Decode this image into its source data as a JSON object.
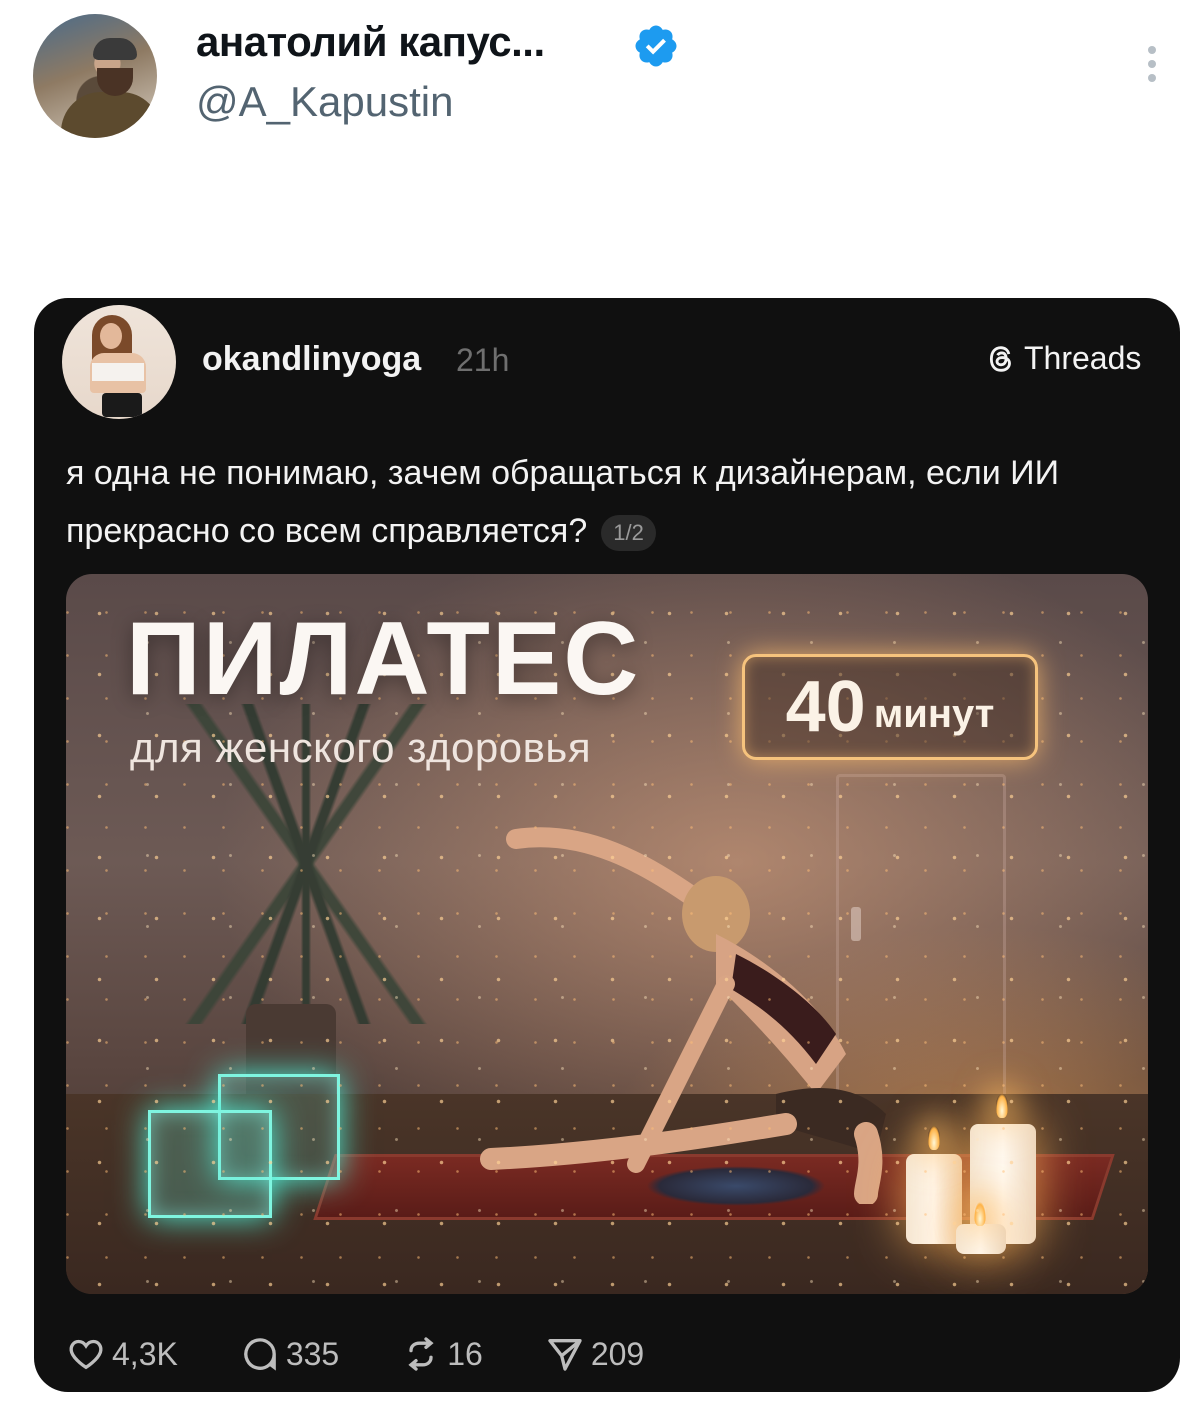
{
  "tweet": {
    "author_name": "анатолий капус...",
    "author_handle": "@A_Kapustin",
    "verified": true,
    "accent_color": "#1d9bf0"
  },
  "embedded_post": {
    "platform": "Threads",
    "username": "okandlinyoga",
    "time": "21h",
    "text": "я одна не понимаю, зачем обращаться к дизайнерам, если ИИ прекрасно со всем справляется?",
    "page_indicator": "1/2",
    "image": {
      "title": "ПИЛАТЕС",
      "subtitle": "для женского здоровья",
      "duration_number": "40",
      "duration_unit": "минут"
    },
    "stats": {
      "likes": "4,3K",
      "comments": "335",
      "reposts": "16",
      "shares": "209"
    }
  }
}
